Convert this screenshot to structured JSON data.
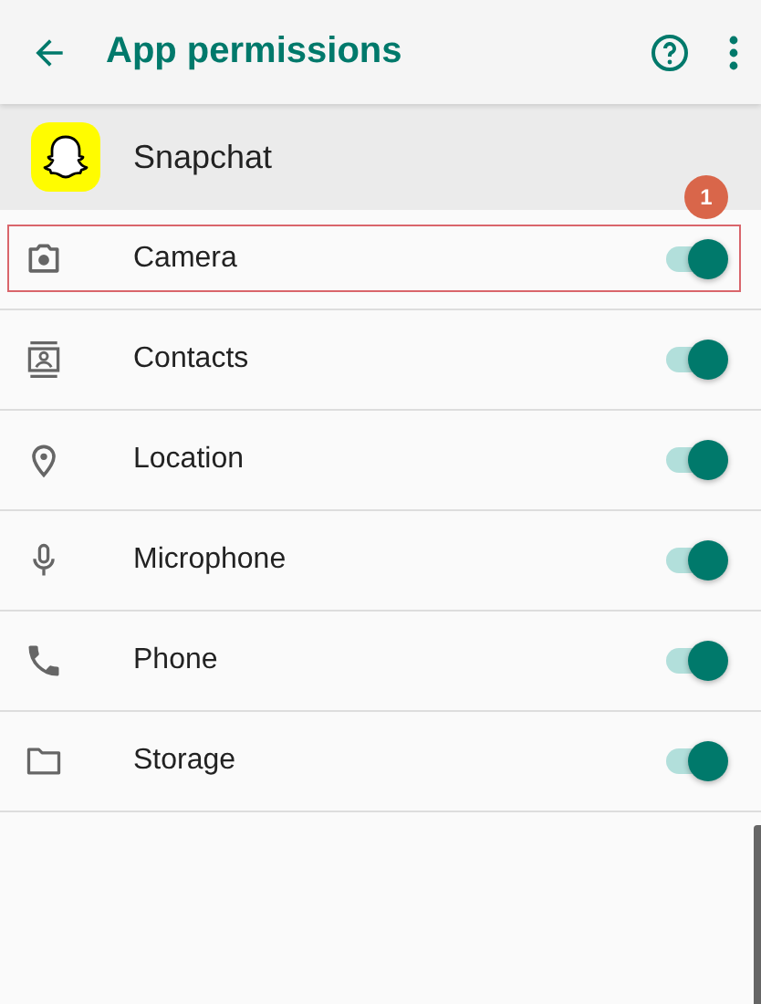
{
  "app_bar": {
    "title": "App permissions"
  },
  "app": {
    "name": "Snapchat"
  },
  "permissions": [
    {
      "kind": "camera",
      "label": "Camera",
      "on": true,
      "annotation": "1"
    },
    {
      "kind": "contacts",
      "label": "Contacts",
      "on": true
    },
    {
      "kind": "location",
      "label": "Location",
      "on": true
    },
    {
      "kind": "microphone",
      "label": "Microphone",
      "on": true
    },
    {
      "kind": "phone",
      "label": "Phone",
      "on": true
    },
    {
      "kind": "storage",
      "label": "Storage",
      "on": true
    }
  ]
}
